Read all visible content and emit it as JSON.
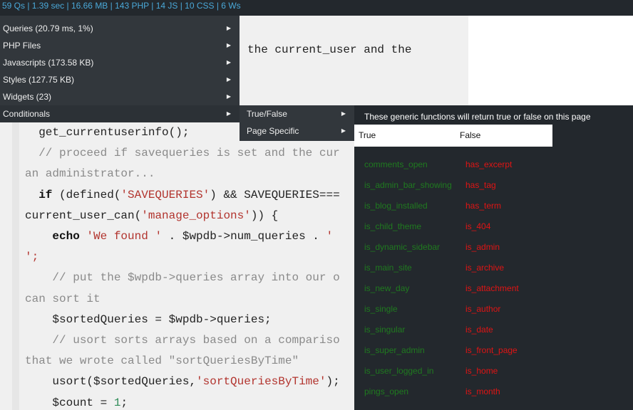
{
  "stats_bar": {
    "text": "59 Qs | 1.39 sec | 16.66 MB | 143 PHP | 14 JS | 10 CSS | 6 Ws"
  },
  "menu": {
    "items": [
      {
        "label": "Queries (20.79 ms, 1%)"
      },
      {
        "label": "PHP Files"
      },
      {
        "label": "Javascripts (173.58 KB)"
      },
      {
        "label": "Styles (127.75 KB)"
      },
      {
        "label": "Widgets (23)"
      },
      {
        "label": "Conditionals"
      }
    ],
    "arrow_glyph": "▶"
  },
  "submenu": {
    "items": [
      {
        "label": "True/False"
      },
      {
        "label": "Page Specific"
      }
    ]
  },
  "panel": {
    "description": "These generic functions will return true or false on this page",
    "header_true": "True",
    "header_false": "False",
    "true_functions": [
      "comments_open",
      "is_admin_bar_showing",
      "is_blog_installed",
      "is_child_theme",
      "is_dynamic_sidebar",
      "is_main_site",
      "is_new_day",
      "is_single",
      "is_singular",
      "is_super_admin",
      "is_user_logged_in",
      "pings_open"
    ],
    "false_functions": [
      "has_excerpt",
      "has_tag",
      "has_term",
      "is_404",
      "is_admin",
      "is_archive",
      "is_attachment",
      "is_author",
      "is_date",
      "is_front_page",
      "is_home",
      "is_month"
    ]
  },
  "code": {
    "line_partial_top": "the current_user and the",
    "lines": [
      {
        "parts": [
          {
            "t": "  get_currentuserinfo();",
            "c": ""
          }
        ]
      },
      {
        "parts": [
          {
            "t": "  // proceed if savequeries is set and the cur",
            "c": "cmt"
          }
        ]
      },
      {
        "parts": [
          {
            "t": "an administrator...",
            "c": "cmt"
          }
        ]
      },
      {
        "parts": [
          {
            "t": "  ",
            "c": ""
          },
          {
            "t": "if",
            "c": "kw"
          },
          {
            "t": " (defined(",
            "c": ""
          },
          {
            "t": "'SAVEQUERIES'",
            "c": "str"
          },
          {
            "t": ") && SAVEQUERIES===",
            "c": ""
          }
        ]
      },
      {
        "parts": [
          {
            "t": "current_user_can(",
            "c": ""
          },
          {
            "t": "'manage_options'",
            "c": "str"
          },
          {
            "t": ")) {",
            "c": ""
          }
        ]
      },
      {
        "parts": [
          {
            "t": "    ",
            "c": ""
          },
          {
            "t": "echo",
            "c": "kw"
          },
          {
            "t": " ",
            "c": ""
          },
          {
            "t": "'We found '",
            "c": "str"
          },
          {
            "t": " . $wpdb->num_queries . ",
            "c": ""
          },
          {
            "t": "'",
            "c": "str"
          }
        ]
      },
      {
        "parts": [
          {
            "t": "';",
            "c": "str"
          }
        ]
      },
      {
        "parts": [
          {
            "t": "    // put the $wpdb->queries array into our o",
            "c": "cmt"
          }
        ]
      },
      {
        "parts": [
          {
            "t": "can sort it",
            "c": "cmt"
          }
        ]
      },
      {
        "parts": [
          {
            "t": "    $sortedQueries = $wpdb->queries;",
            "c": ""
          }
        ]
      },
      {
        "parts": [
          {
            "t": "    // usort sorts arrays based on a compariso",
            "c": "cmt"
          }
        ]
      },
      {
        "parts": [
          {
            "t": "that we wrote called \"sortQueriesByTime\"",
            "c": "cmt"
          }
        ]
      },
      {
        "parts": [
          {
            "t": "    usort($sortedQueries,",
            "c": ""
          },
          {
            "t": "'sortQueriesByTime'",
            "c": "str"
          },
          {
            "t": ");",
            "c": ""
          }
        ]
      },
      {
        "parts": [
          {
            "t": "    $count = ",
            "c": ""
          },
          {
            "t": "1",
            "c": "num"
          },
          {
            "t": ";",
            "c": ""
          }
        ]
      }
    ]
  }
}
